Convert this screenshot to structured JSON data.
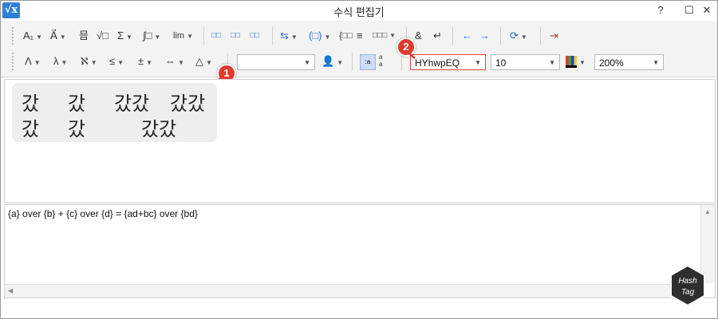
{
  "window": {
    "icon_text": "√x",
    "title": "수식 편집기",
    "help_label": "?",
    "maximize_label": "☐",
    "close_label": "✕"
  },
  "toolbar_row1": {
    "items": [
      "A₁",
      "A⃗",
      "믐",
      "√□",
      "Σ",
      "∫□",
      "lim",
      "□□",
      "□□",
      "□□",
      "⇆",
      "(□)",
      "{□□",
      "≡",
      "□□□",
      "&",
      "↵",
      "←",
      "→",
      "⟳",
      "⇥"
    ]
  },
  "toolbar_row2": {
    "items": [
      "Λ",
      "λ",
      "ℵ",
      "≤",
      "±",
      "⇔",
      "△"
    ],
    "style_combo_value": "",
    "font_combo_value": "HYhwpEQ",
    "size_combo_value": "10",
    "zoom_combo_value": "200%"
  },
  "badges": {
    "badge1": "1",
    "badge2": "2"
  },
  "preview": {
    "line1": [
      "갔",
      "갔",
      "갔갔",
      "갔갔"
    ],
    "line2": [
      "갔",
      "갔",
      "갔갔"
    ]
  },
  "editor": {
    "script": "{a} over {b} + {c} over {d} = {ad+bc} over {bd}"
  },
  "watermark": {
    "text1": "Hash",
    "text2": "Tag"
  },
  "colors": {
    "accent_red": "#e03a2f",
    "app_icon_blue": "#2f7fd7",
    "watermark_dark": "#2e2e2e"
  }
}
